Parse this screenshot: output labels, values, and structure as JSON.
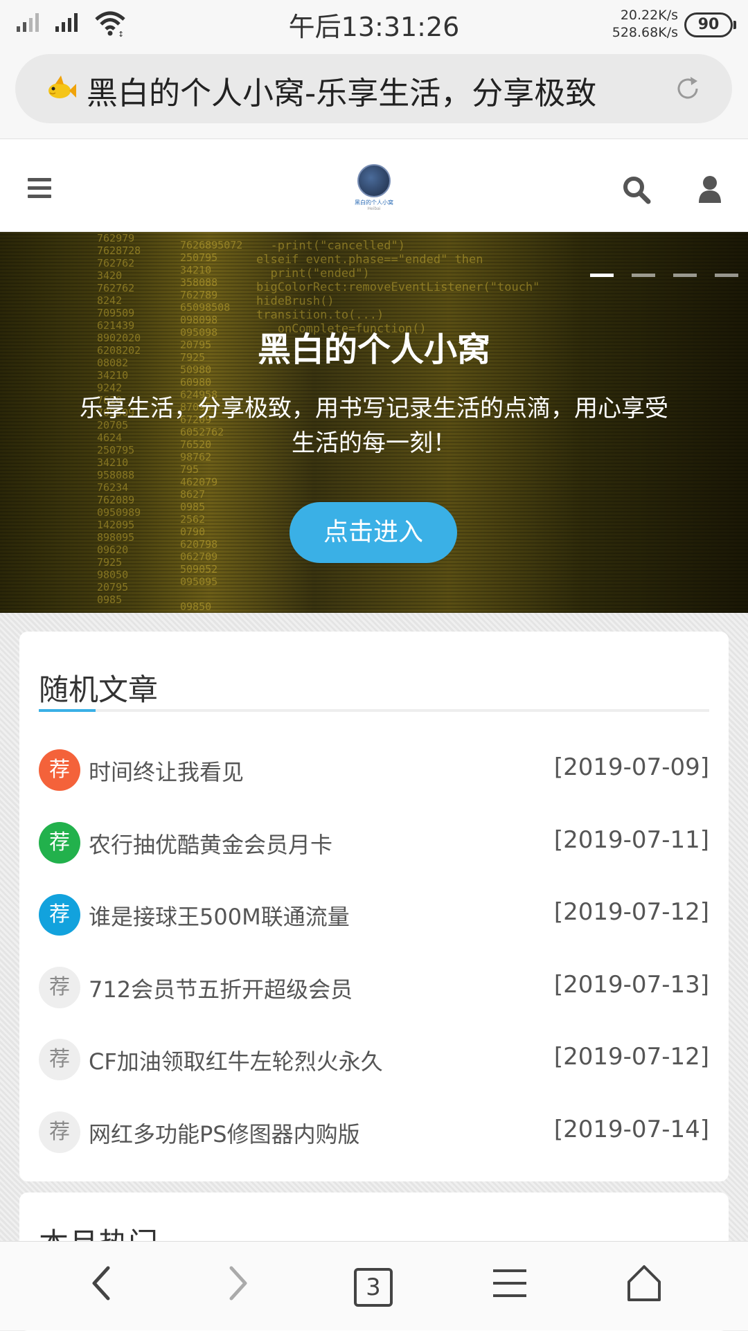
{
  "status_bar": {
    "time": "午后13:31:26",
    "net_up": "20.22K/s",
    "net_down": "528.68K/s",
    "battery": "90"
  },
  "browser": {
    "page_title": "黑白的个人小窝-乐享生活，分享极致",
    "tab_count": "3"
  },
  "site": {
    "logo_text": "黑白的个人小窝",
    "logo_sub": "Heibai"
  },
  "hero": {
    "title": "黑白的个人小窝",
    "description": "乐享生活，分享极致，用书写记录生活的点滴，用心享受生活的每一刻！",
    "button": "点击进入",
    "slide_count": 4,
    "active_slide": 1
  },
  "random_articles": {
    "title": "随机文章",
    "accent_color": "#3ab0e6",
    "items": [
      {
        "badge": "荐",
        "badge_color": "#f4623a",
        "title": "时间终让我看见",
        "date": "[2019-07-09]"
      },
      {
        "badge": "荐",
        "badge_color": "#22b14c",
        "title": "农行抽优酷黄金会员月卡",
        "date": "[2019-07-11]"
      },
      {
        "badge": "荐",
        "badge_color": "#12a2dd",
        "title": "谁是接球王500M联通流量",
        "date": "[2019-07-12]"
      },
      {
        "badge": "荐",
        "badge_color": "grey",
        "title": "712会员节五折开超级会员",
        "date": "[2019-07-13]"
      },
      {
        "badge": "荐",
        "badge_color": "grey",
        "title": "CF加油领取红牛左轮烈火永久",
        "date": "[2019-07-12]"
      },
      {
        "badge": "荐",
        "badge_color": "grey",
        "title": "网红多功能PS修图器内购版",
        "date": "[2019-07-14]"
      }
    ]
  },
  "monthly_hot": {
    "title": "本月热门"
  },
  "icons": [
    "signal-icon",
    "wifi-icon",
    "fish-icon",
    "reload-icon",
    "menu-icon",
    "search-icon",
    "user-icon",
    "back-icon",
    "forward-icon",
    "tabs-icon",
    "browser-menu-icon",
    "home-icon"
  ]
}
